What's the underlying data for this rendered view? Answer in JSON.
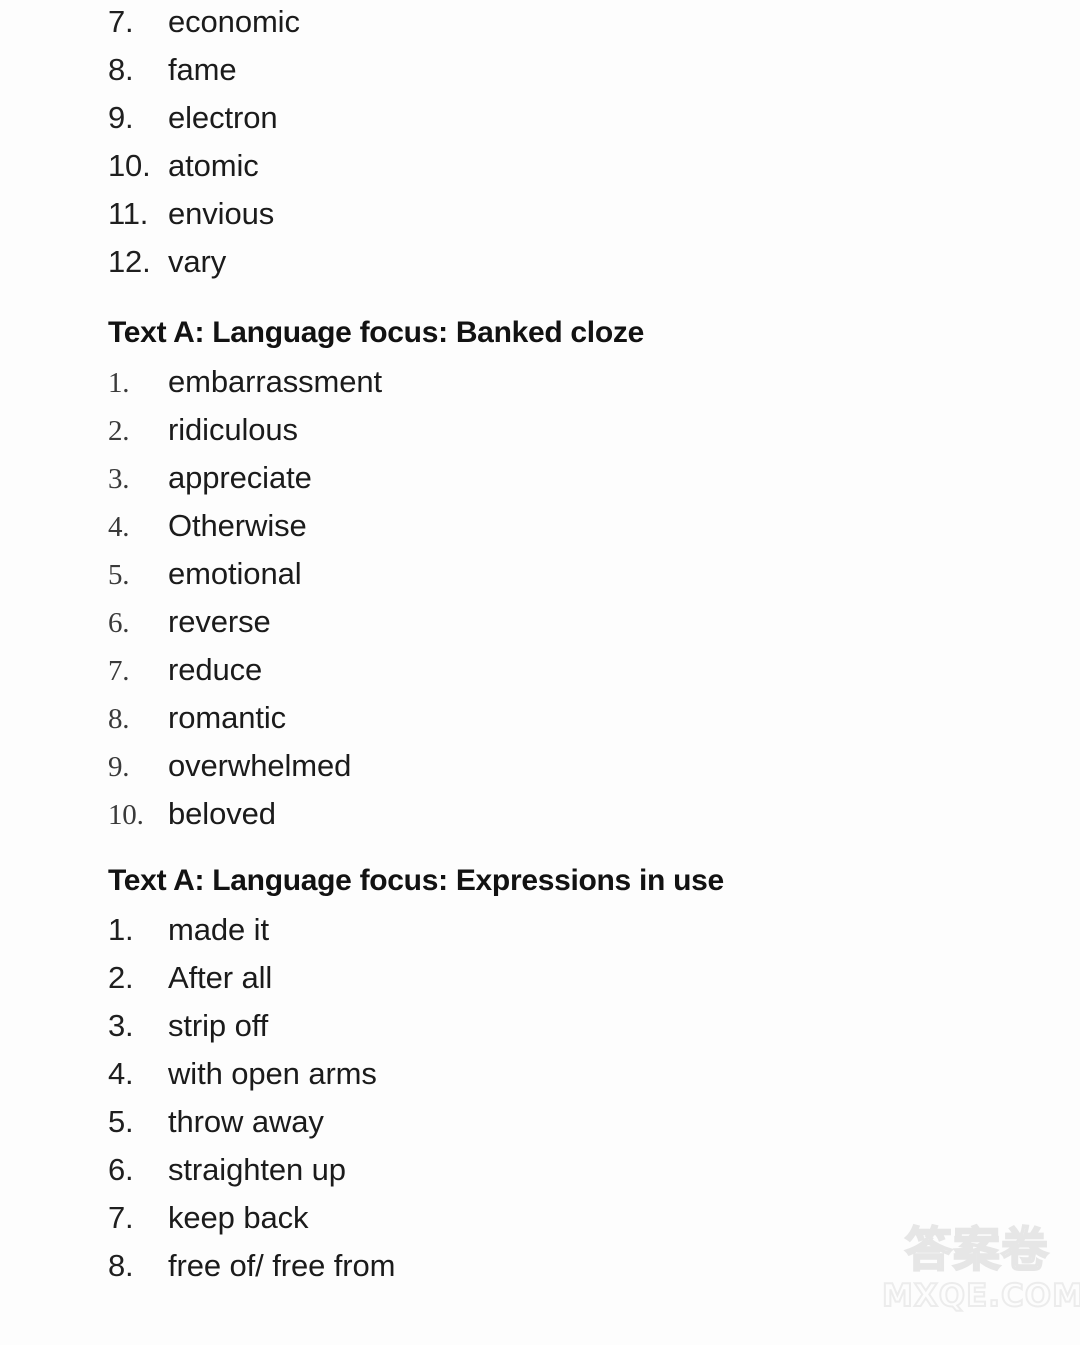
{
  "document": {
    "background_color": "#fdfdfd",
    "text_color": "#1a1a1a"
  },
  "sections": [
    {
      "id": "vocabulary-continued",
      "heading": null,
      "number_style": "sans",
      "items": [
        {
          "num": "7.",
          "text": "economic"
        },
        {
          "num": "8.",
          "text": "fame"
        },
        {
          "num": "9.",
          "text": "electron"
        },
        {
          "num": "10.",
          "text": "atomic"
        },
        {
          "num": "11.",
          "text": "envious"
        },
        {
          "num": "12.",
          "text": "vary"
        }
      ]
    },
    {
      "id": "banked-cloze",
      "heading": "Text A: Language focus: Banked cloze",
      "number_style": "serif",
      "items": [
        {
          "num": "1.",
          "text": "embarrassment"
        },
        {
          "num": "2.",
          "text": "ridiculous"
        },
        {
          "num": "3.",
          "text": "appreciate"
        },
        {
          "num": "4.",
          "text": "Otherwise"
        },
        {
          "num": "5.",
          "text": "emotional"
        },
        {
          "num": "6.",
          "text": "reverse"
        },
        {
          "num": "7.",
          "text": "reduce"
        },
        {
          "num": "8.",
          "text": "romantic"
        },
        {
          "num": "9.",
          "text": "overwhelmed"
        },
        {
          "num": "10.",
          "text": "beloved"
        }
      ]
    },
    {
      "id": "expressions-in-use",
      "heading": "Text A: Language focus: Expressions in use",
      "number_style": "sans",
      "items": [
        {
          "num": "1.",
          "text": "made it"
        },
        {
          "num": "2.",
          "text": "After all"
        },
        {
          "num": "3.",
          "text": "strip off"
        },
        {
          "num": "4.",
          "text": "with open arms"
        },
        {
          "num": "5.",
          "text": "throw away"
        },
        {
          "num": "6.",
          "text": "straighten up"
        },
        {
          "num": "7.",
          "text": "keep back"
        },
        {
          "num": "8.",
          "text": "free of/ free from"
        }
      ]
    }
  ],
  "watermark": {
    "chinese": "答案卷",
    "site": "MXQE.COM",
    "color": "#e6e6e6"
  }
}
